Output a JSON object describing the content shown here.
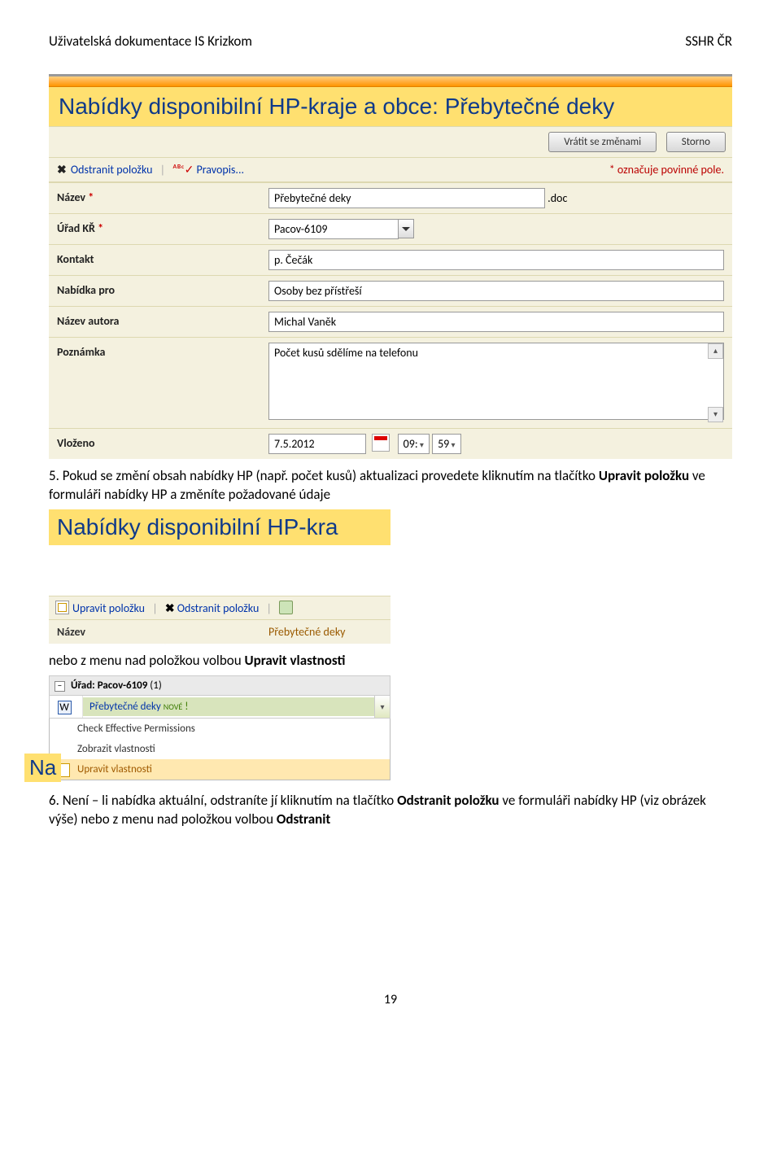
{
  "header": {
    "left": "Uživatelská dokumentace IS Krizkom",
    "right": "SSHR ČR"
  },
  "sc1": {
    "title": "Nabídky disponibilní HP-kraje a obce: Přebytečné deky",
    "btn_back": "Vrátit se změnami",
    "btn_cancel": "Storno",
    "tool_remove": "Odstranit položku",
    "tool_spell": "Pravopis...",
    "req_note": "* označuje povinné pole.",
    "fields": {
      "name_lab": "Název",
      "name_val": "Přebytečné deky",
      "ext": ".doc",
      "urad_lab": "Úřad KŘ",
      "urad_val": "Pacov-6109",
      "kontakt_lab": "Kontakt",
      "kontakt_val": "p. Čečák",
      "nabpro_lab": "Nabídka pro",
      "nabpro_val": "Osoby bez přístřeší",
      "autor_lab": "Název autora",
      "autor_val": "Michal Vaněk",
      "pozn_lab": "Poznámka",
      "pozn_val": "Počet kusů sdělíme na telefonu",
      "vloz_lab": "Vloženo",
      "vloz_date": "7.5.2012",
      "vloz_h": "09:",
      "vloz_m": "59"
    }
  },
  "para1": "5. Pokud se změní obsah nabídky HP (např. počet kusů) aktualizaci provedete kliknutím na tlačítko ",
  "para1b": "Upravit položku",
  "para1c": " ve formuláři nabídky HP a změníte požadované údaje",
  "sc2": {
    "title": "Nabídky disponibilní HP-kra",
    "edit": "Upravit položku",
    "remove": "Odstranit položku",
    "name_lab": "Název",
    "name_val": "Přebytečné deky"
  },
  "para2a": "nebo z menu nad položkou volbou ",
  "para2b": "Upravit vlastnosti",
  "sc3": {
    "group": "Úřad",
    "group_val": ": Pacov-6109",
    "count": "(1)",
    "item": "Přebytečné deky",
    "nove": "NOVÉ",
    "m1": "Check Effective Permissions",
    "m2": "Zobrazit vlastnosti",
    "m3": "Upravit vlastnosti",
    "na": "Na"
  },
  "para3a": "6. Není – li nabídka aktuální, odstraníte jí kliknutím na tlačítko ",
  "para3b": "Odstranit položku",
  "para3c": " ve formuláři nabídky HP (viz obrázek výše) nebo z menu nad položkou volbou ",
  "para3d": "Odstranit",
  "page_num": "19"
}
